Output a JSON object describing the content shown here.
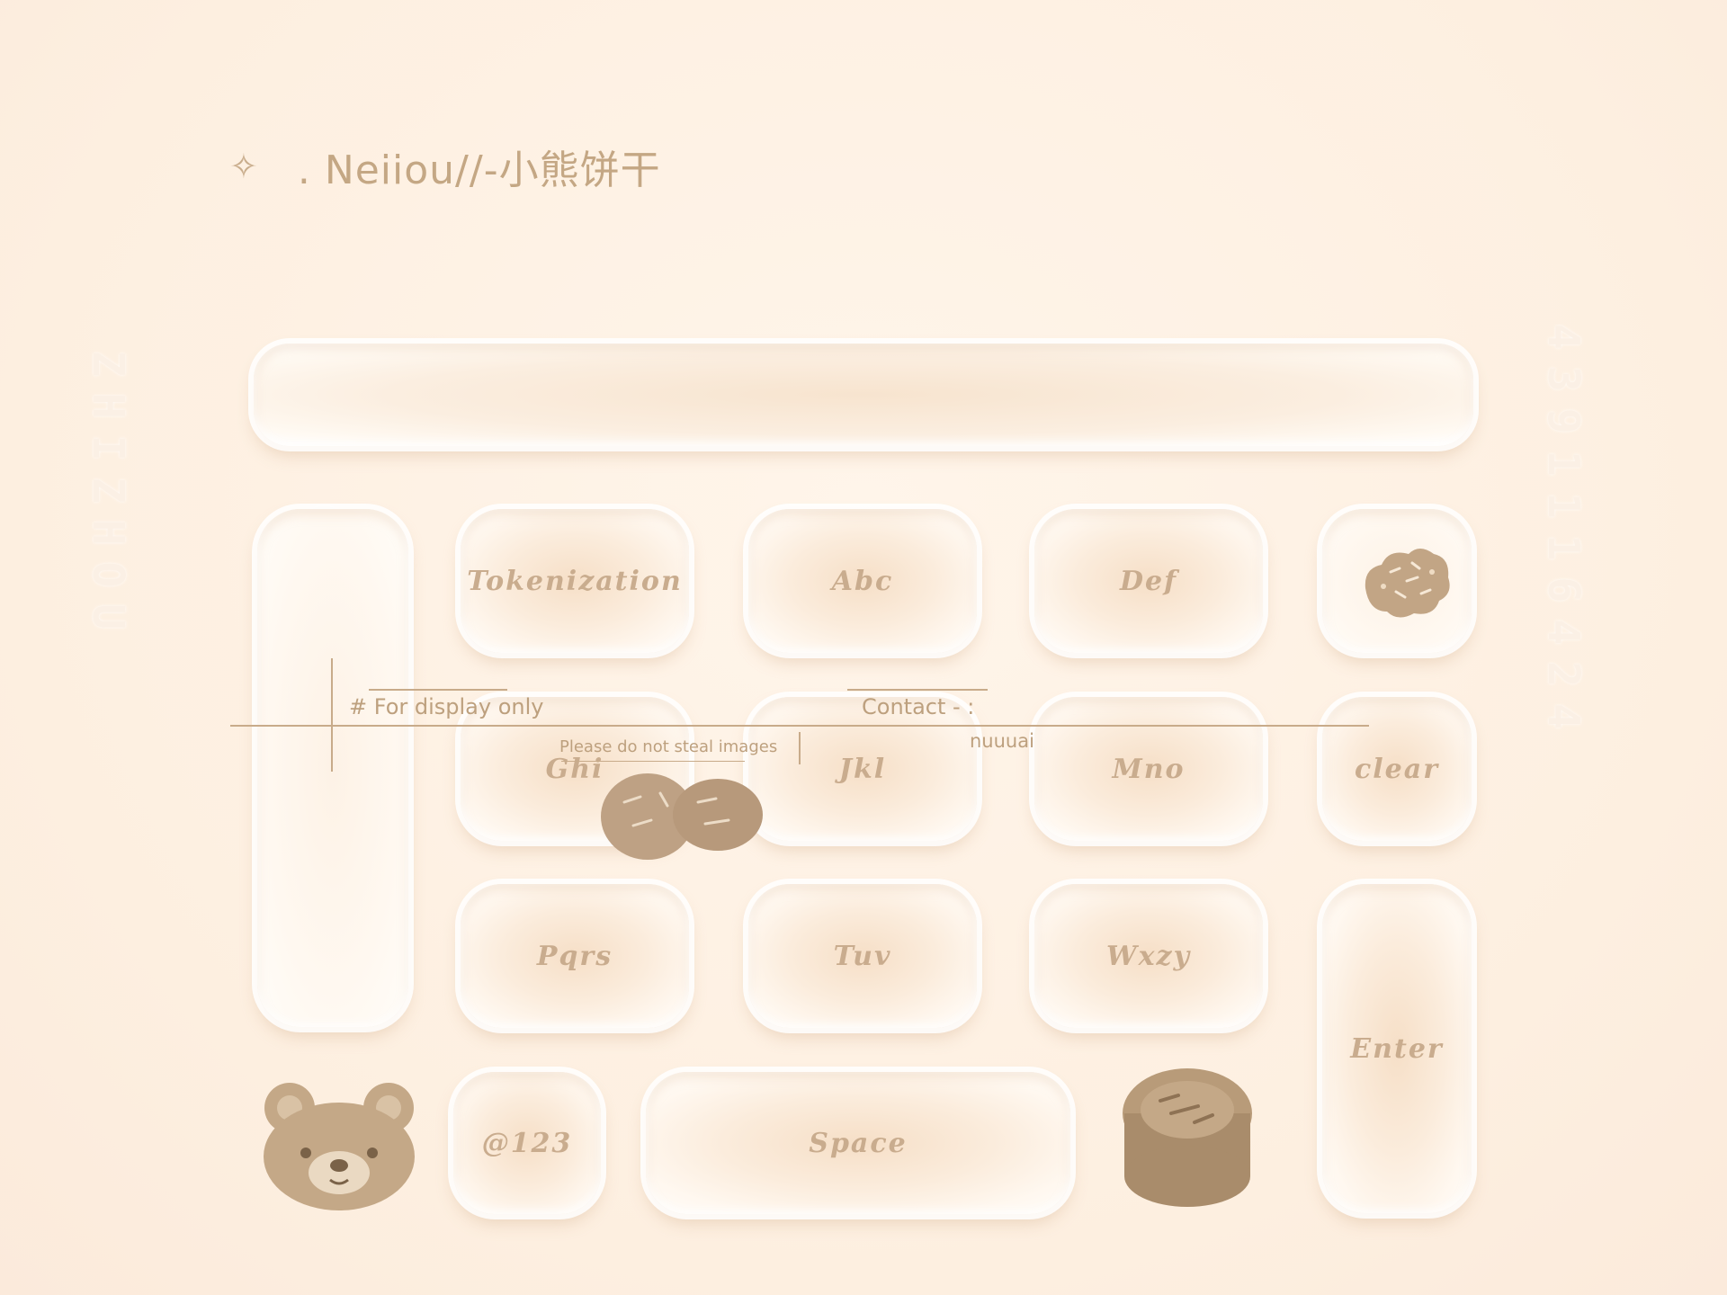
{
  "header": {
    "sparkle_icon": "✧",
    "title": ". Neiiou//-小熊饼干"
  },
  "side_text": {
    "left": "ZHIZHOU",
    "right": "4391116424",
    "inner": "6424"
  },
  "keyboard": {
    "search_bar_value": "",
    "keys": {
      "tokenization": "Tokenization",
      "abc": "Abc",
      "def": "Def",
      "ghi": "Ghi",
      "jkl": "Jkl",
      "mno": "Mno",
      "clear": "clear",
      "pqrs": "Pqrs",
      "tuv": "Tuv",
      "wxyz": "Wxzy",
      "enter": "Enter",
      "at123": "@123",
      "space": "Space"
    }
  },
  "annotations": {
    "display_only": "# For display only",
    "no_steal": "Please do not steal images",
    "contact_label": "Contact - :",
    "contact_value": "nuuuai"
  },
  "colors": {
    "background": "#fdf0e2",
    "text": "#c4a784",
    "cookie": "#b79b7a"
  },
  "icons": {
    "cookie": "cookie-icon",
    "bear": "bear-icon",
    "mooncake": "mooncake-icon"
  }
}
